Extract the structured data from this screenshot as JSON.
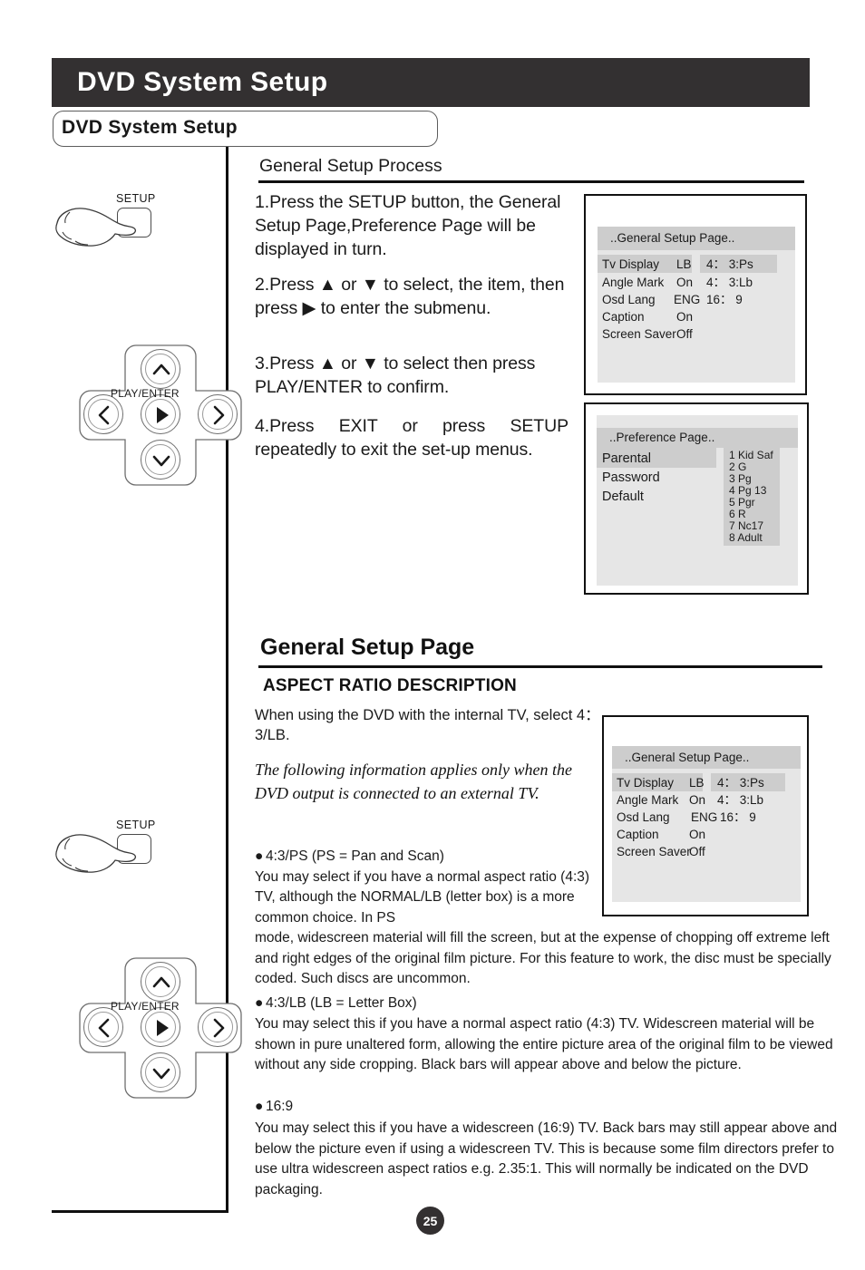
{
  "header": {
    "title": "DVD System Setup",
    "subtitle": "DVD System Setup"
  },
  "general_setup_process": {
    "heading": "General Setup Process",
    "steps": [
      "1.Press the SETUP button, the General Setup Page,Preference Page  will be displayed in turn.",
      "2.Press ▲ or ▼  to select, the item, then press ▶ to enter the submenu.",
      "3.Press ▲ or ▼  to select then press PLAY/ENTER to confirm.",
      "4.Press  EXIT or press SETUP repeatedly  to  exit  the  set-up menus."
    ]
  },
  "remote_top": {
    "setup_label": "SETUP",
    "play_enter_label": "PLAY/ENTER",
    "up_icon": "chevron-up-icon",
    "down_icon": "chevron-down-icon",
    "left_icon": "chevron-left-icon",
    "right_icon": "chevron-right-icon",
    "center_icon": "play-icon",
    "hand_icon": "pointing-hand-icon"
  },
  "remote_bottom": {
    "setup_label": "SETUP",
    "play_enter_label": "PLAY/ENTER",
    "up_icon": "chevron-up-icon",
    "down_icon": "chevron-down-icon",
    "left_icon": "chevron-left-icon",
    "right_icon": "chevron-right-icon",
    "center_icon": "play-icon",
    "hand_icon": "pointing-hand-icon"
  },
  "osd_general_1": {
    "title": "..General Setup Page..",
    "rows": [
      {
        "label": "Tv Display",
        "value": "LB",
        "option": "4： 3:Ps",
        "selected": true
      },
      {
        "label": "Angle Mark",
        "value": "On",
        "option": "4： 3:Lb",
        "selected": false
      },
      {
        "label": "Osd Lang",
        "value": "ENG",
        "option": "16： 9",
        "selected": false
      },
      {
        "label": "Caption",
        "value": "On",
        "option": "",
        "selected": false
      },
      {
        "label": "Screen Saver",
        "value": "Off",
        "option": "",
        "selected": false
      }
    ]
  },
  "osd_preference": {
    "title": "..Preference Page..",
    "rows": [
      {
        "label": "Parental",
        "selected": true
      },
      {
        "label": "Password",
        "selected": false
      },
      {
        "label": "Default",
        "selected": false
      }
    ],
    "options": [
      "1 Kid Saf",
      "2 G",
      "3 Pg",
      "4 Pg 13",
      "5 Pgr",
      "6 R",
      "7 Nc17",
      "8 Adult"
    ]
  },
  "osd_general_2": {
    "title": "..General Setup Page..",
    "rows": [
      {
        "label": "Tv Display",
        "value": "LB",
        "option": "4： 3:Ps",
        "selected": true
      },
      {
        "label": "Angle Mark",
        "value": "On",
        "option": "4： 3:Lb",
        "selected": false
      },
      {
        "label": "Osd Lang",
        "value": "ENG",
        "option": "16： 9",
        "selected": false
      },
      {
        "label": "Caption",
        "value": "On",
        "option": "",
        "selected": false
      },
      {
        "label": "Screen Saver",
        "value": "Off",
        "option": "",
        "selected": false
      }
    ]
  },
  "general_setup_page": {
    "heading": "General Setup Page",
    "aspect_heading": "ASPECT RATIO DESCRIPTION",
    "intro": "When using the DVD with the internal TV, select 4： 3/LB.",
    "italic_note": "The following information applies only when the DVD output is connected to an external TV.",
    "ps_bullet": "4:3/PS (PS = Pan and Scan)",
    "ps_body_a": "You may select if you have a normal aspect ratio (4:3) TV, although the NORMAL/LB (letter box) is a more common choice. In PS",
    "ps_body_b": "mode, widescreen material will fill the screen, but at the expense of chopping off extreme left and right edges of the original film picture. For this feature to work, the disc must be specially coded. Such discs are uncommon.",
    "lb_bullet": "4:3/LB (LB = Letter Box)",
    "lb_body": "You may select this if you have a normal aspect ratio (4:3) TV. Widescreen material will be shown in pure unaltered form, allowing the entire picture area of the original film to be viewed without any side cropping. Black bars will appear above and below the picture.",
    "w169_bullet": "16:9",
    "w169_body": "You may select this if you have a widescreen (16:9) TV. Back bars may still appear above and below the picture even if using a widescreen TV. This is because some film directors prefer to use ultra widescreen aspect ratios e.g. 2.35:1. This will normally be indicated on the DVD packaging."
  },
  "footer": {
    "page_number": "25"
  },
  "colors": {
    "header_bg": "#333031",
    "osd_screen": "#e6e6e6",
    "osd_highlight": "#cdcdcd",
    "rule": "#0f0f0f"
  }
}
